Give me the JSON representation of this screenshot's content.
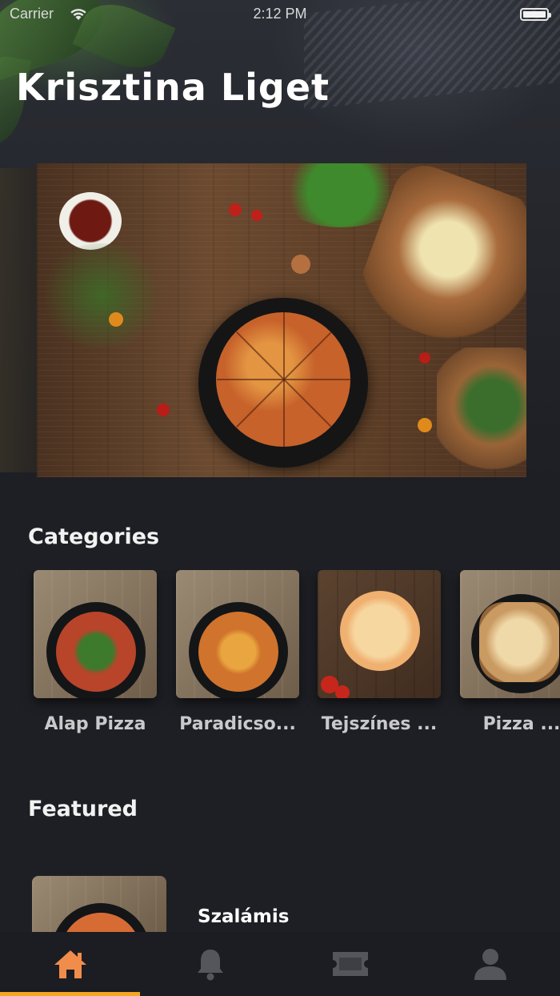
{
  "status_bar": {
    "carrier": "Carrier",
    "time": "2:12 PM"
  },
  "header": {
    "title": "Krisztina Liget"
  },
  "sections": {
    "categories_title": "Categories",
    "featured_title": "Featured"
  },
  "categories": [
    {
      "label": "Alap Pizza"
    },
    {
      "label": "Paradicso..."
    },
    {
      "label": "Tejszínes ..."
    },
    {
      "label": "Pizza ..."
    }
  ],
  "featured": [
    {
      "name": "Szalámis"
    }
  ],
  "tab_bar": {
    "tabs": [
      {
        "icon": "home-icon",
        "active": true
      },
      {
        "icon": "bell-icon",
        "active": false
      },
      {
        "icon": "ticket-icon",
        "active": false
      },
      {
        "icon": "user-icon",
        "active": false
      }
    ]
  },
  "colors": {
    "background": "#1e1f24",
    "accent_active": "#f28c4b",
    "indicator": "#f5a623",
    "inactive_icon": "#5a5b61"
  }
}
